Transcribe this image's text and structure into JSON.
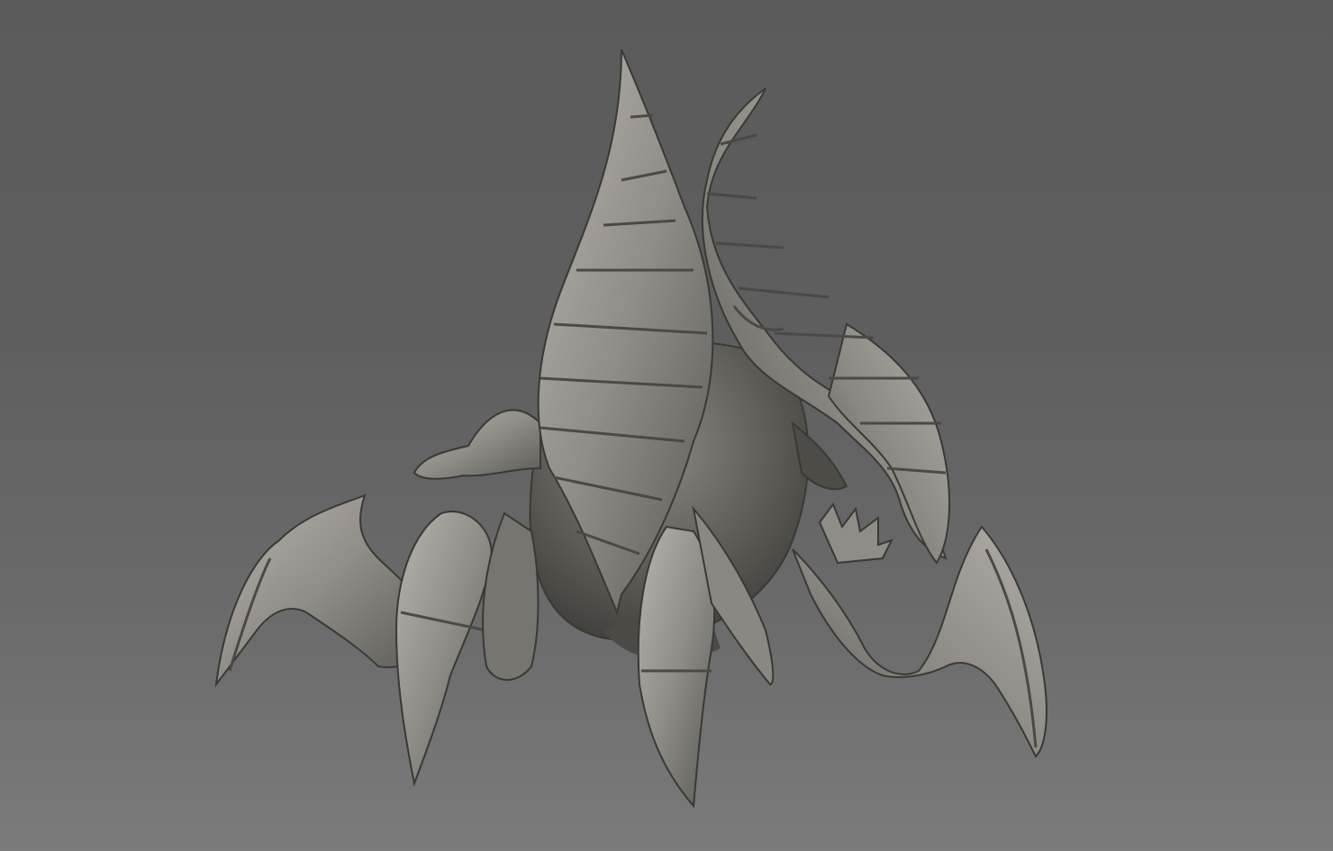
{
  "viewport": {
    "background_top": "#5b5b5b",
    "background_bottom": "#7b7b7b"
  },
  "model": {
    "subject": "sculpted-creature-model",
    "material_base": "#8f8d86",
    "material_light": "#b4b2aa",
    "material_dark": "#4a4944",
    "outline": "#3a3935"
  }
}
